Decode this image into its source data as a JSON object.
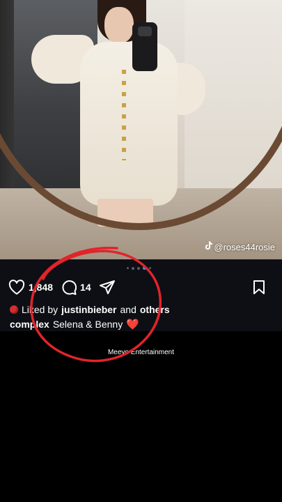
{
  "post": {
    "watermark_handle": "@roses44rosie",
    "carousel": {
      "total": 5,
      "active_index": 3
    },
    "likes_count": "1,848",
    "comments_count": "14",
    "liked_by_prefix": "Liked by",
    "liked_by_user": "justinbieber",
    "liked_by_and": "and",
    "liked_by_others": "others",
    "caption_user": "complex",
    "caption_text": "Selena & Benny",
    "caption_emoji": "❤️"
  },
  "credit": "Meevo Entertainment",
  "icons": [
    "tiktok-icon",
    "heart-icon",
    "comment-icon",
    "share-icon",
    "bookmark-icon"
  ],
  "colors": {
    "background": "#000000",
    "annotation_red": "#e0242b",
    "active_dot": "#3897f0"
  }
}
